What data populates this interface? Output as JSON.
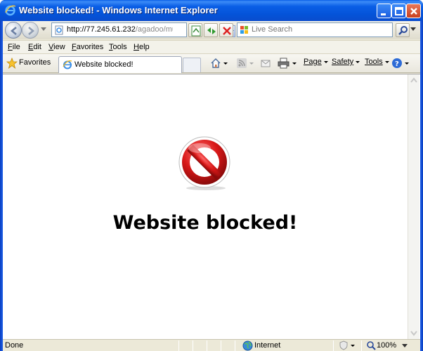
{
  "window": {
    "title": "Website blocked! - Windows Internet Explorer"
  },
  "navigation": {
    "address": {
      "host": "http://77.245.61.232",
      "path": "/agadoo/multi"
    },
    "search": {
      "placeholder": "Live Search"
    }
  },
  "menubar": {
    "items": [
      {
        "label": "File",
        "accel": "F",
        "rest": "ile"
      },
      {
        "label": "Edit",
        "accel": "E",
        "rest": "dit"
      },
      {
        "label": "View",
        "accel": "V",
        "rest": "iew"
      },
      {
        "label": "Favorites",
        "accel": "F",
        "rest": "avorites"
      },
      {
        "label": "Tools",
        "accel": "T",
        "rest": "ools"
      },
      {
        "label": "Help",
        "accel": "H",
        "rest": "elp"
      }
    ]
  },
  "commandbar": {
    "favorites_label": "Favorites",
    "tab_label": "Website blocked!",
    "page_label": "Page",
    "safety_label": "Safety",
    "tools_label": "Tools"
  },
  "content": {
    "heading": "Website blocked!",
    "icon": "blocked-icon"
  },
  "statusbar": {
    "status": "Done",
    "zone": "Internet",
    "zoom": "100%"
  }
}
